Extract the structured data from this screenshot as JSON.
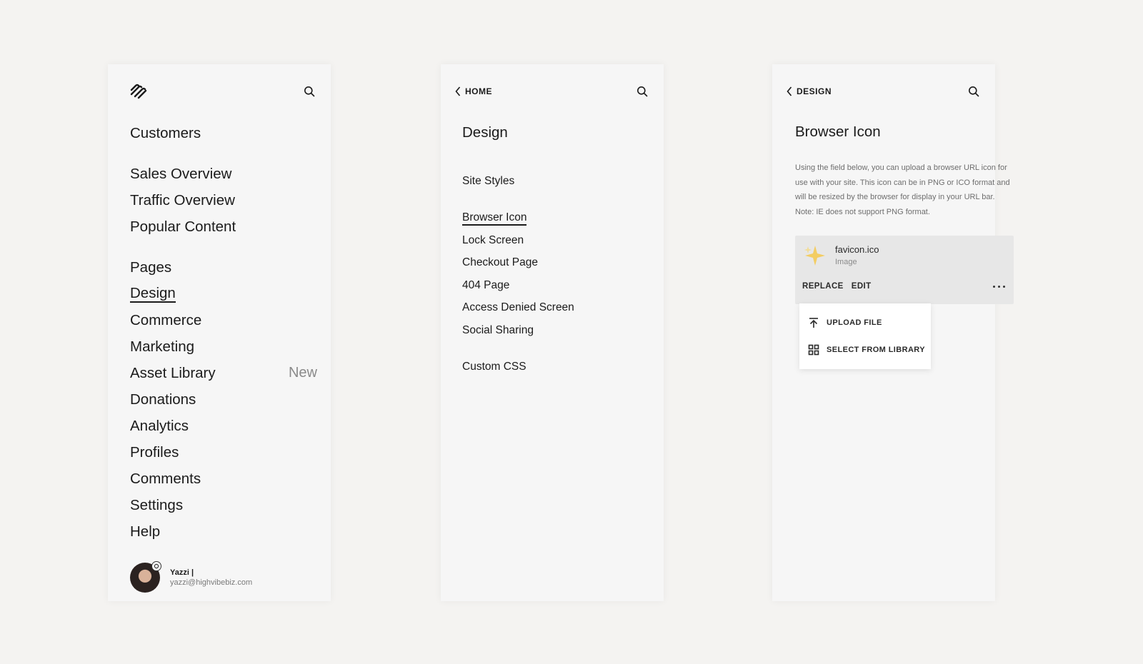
{
  "panel_home": {
    "nav_groups": [
      [
        {
          "label": "Customers"
        }
      ],
      [
        {
          "label": "Sales Overview"
        },
        {
          "label": "Traffic Overview"
        },
        {
          "label": "Popular Content"
        }
      ],
      [
        {
          "label": "Pages"
        },
        {
          "label": "Design",
          "active": true
        },
        {
          "label": "Commerce"
        },
        {
          "label": "Marketing"
        },
        {
          "label": "Asset Library",
          "badge": "New"
        },
        {
          "label": "Donations"
        },
        {
          "label": "Analytics"
        },
        {
          "label": "Profiles"
        },
        {
          "label": "Comments"
        },
        {
          "label": "Settings"
        },
        {
          "label": "Help"
        }
      ]
    ],
    "account": {
      "name": "Yazzi |",
      "email": "yazzi@highvibebiz.com"
    }
  },
  "panel_design": {
    "back_label": "HOME",
    "title": "Design",
    "groups": [
      [
        {
          "label": "Site Styles"
        }
      ],
      [
        {
          "label": "Browser Icon",
          "active": true
        },
        {
          "label": "Lock Screen"
        },
        {
          "label": "Checkout Page"
        },
        {
          "label": "404 Page"
        },
        {
          "label": "Access Denied Screen"
        },
        {
          "label": "Social Sharing"
        }
      ],
      [
        {
          "label": "Custom CSS"
        }
      ]
    ]
  },
  "panel_browser_icon": {
    "back_label": "DESIGN",
    "title": "Browser Icon",
    "description": "Using the field below, you can upload a browser URL icon for use with your site. This icon can be in PNG or ICO format and will be resized by the browser for display in your URL bar. Note: IE does not support PNG format.",
    "file": {
      "name": "favicon.ico",
      "type": "Image",
      "thumb_icon": "sparkles-icon"
    },
    "actions": {
      "replace": "REPLACE",
      "edit": "EDIT"
    },
    "dropdown": {
      "upload": "UPLOAD FILE",
      "library": "SELECT FROM LIBRARY"
    }
  }
}
